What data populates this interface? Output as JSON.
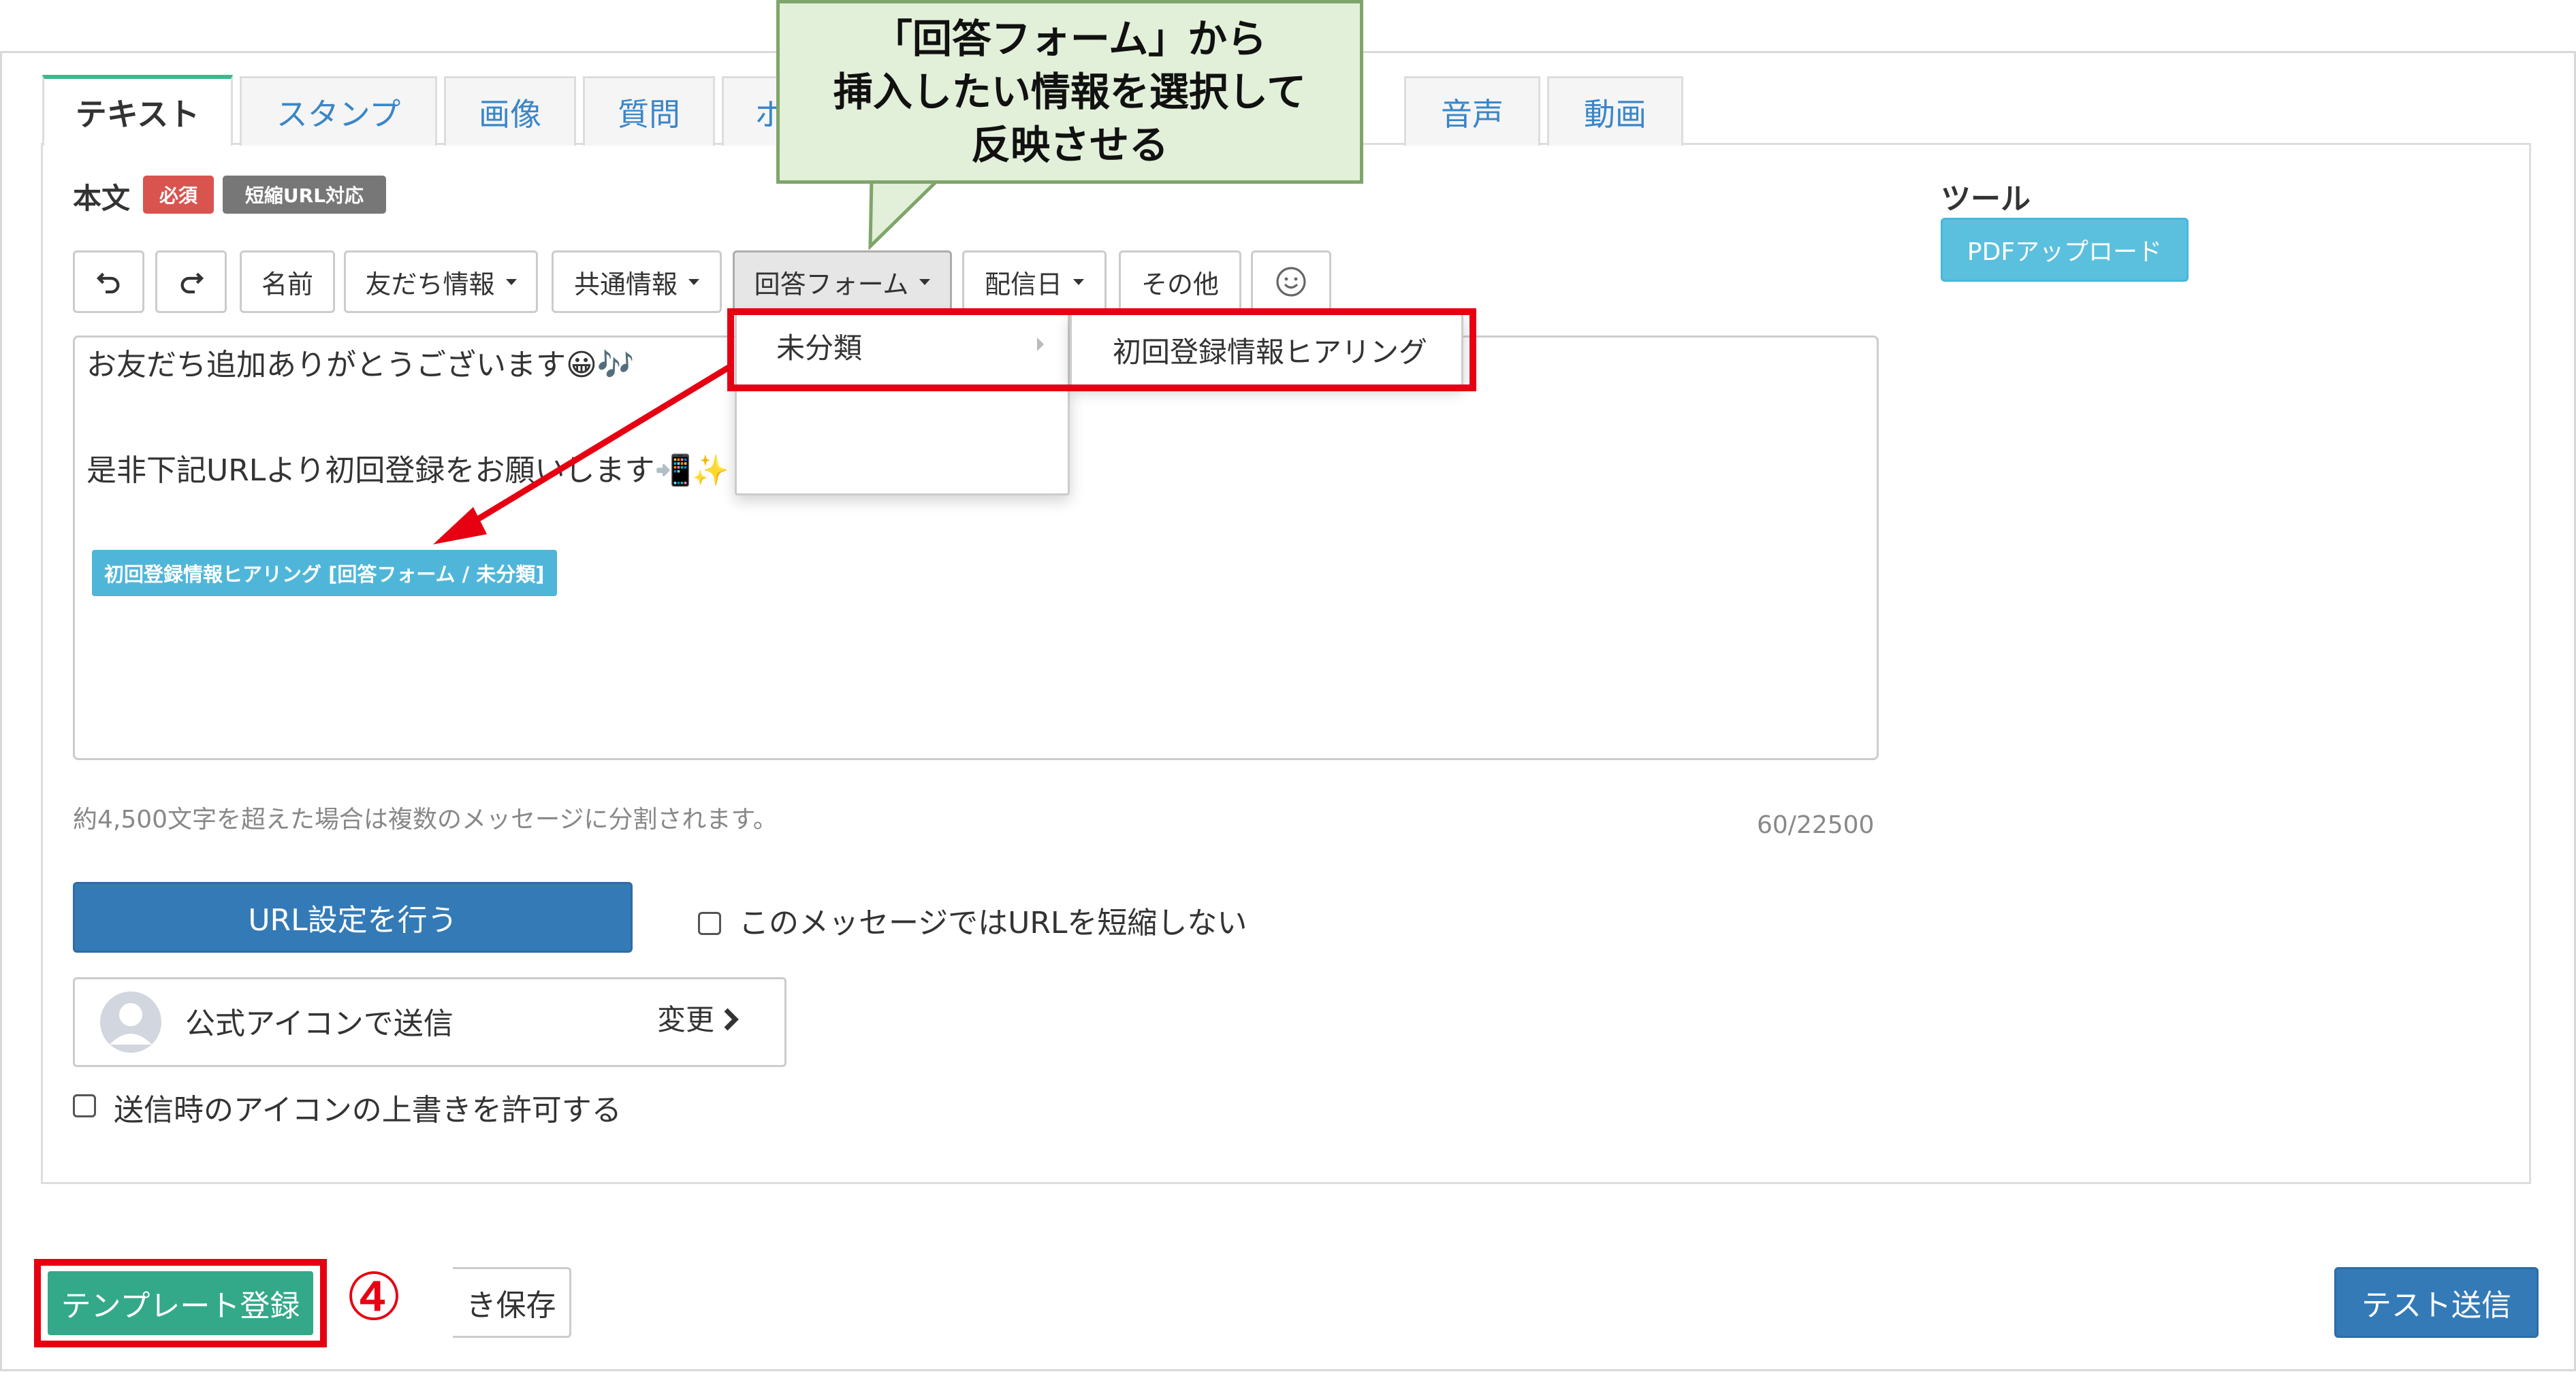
{
  "tabs": [
    {
      "label": "テキスト",
      "active": true
    },
    {
      "label": "スタンプ"
    },
    {
      "label": "画像"
    },
    {
      "label": "質問"
    },
    {
      "label": "ボ"
    },
    {
      "label": "音声"
    },
    {
      "label": "動画"
    }
  ],
  "body_label": "本文",
  "badges": {
    "required": "必須",
    "short_url": "短縮URL対応"
  },
  "toolbar": {
    "name": "名前",
    "friend_info": "友だち情報",
    "common_info": "共通情報",
    "answer_form": "回答フォーム",
    "delivery_date": "配信日",
    "other": "その他"
  },
  "dropdown": {
    "item": "未分類",
    "submenu_item": "初回登録情報ヒアリング"
  },
  "message": {
    "line1": "お友だち追加ありがとうございます😀🎶",
    "line2": "是非下記URLより初回登録をお願いします📲✨",
    "variable_tag": "初回登録情報ヒアリング [回答フォーム / 未分類]"
  },
  "note": "約4,500文字を超えた場合は複数のメッセージに分割されます。",
  "counter": "60/22500",
  "url_button": "URL設定を行う",
  "no_shorten_label": "このメッセージではURLを短縮しない",
  "sender": {
    "label": "公式アイコンで送信",
    "change": "変更"
  },
  "allow_override_label": "送信時のアイコンの上書きを許可する",
  "tools": {
    "heading": "ツール",
    "pdf_upload": "PDFアップロード"
  },
  "footer": {
    "template_register": "テンプレート登録",
    "step_number": "④",
    "draft_save": "き保存",
    "test_send": "テスト送信"
  },
  "callout": {
    "line1": "「回答フォーム」から",
    "line2": "挿入したい情報を選択して",
    "line3": "反映させる"
  },
  "colors": {
    "annotation_red": "#e60012",
    "callout_bg": "#e2efd9",
    "primary_blue": "#337ab7",
    "info_cyan": "#5bc0de",
    "success_green": "#33a98a",
    "tab_accent": "#3db78c"
  }
}
